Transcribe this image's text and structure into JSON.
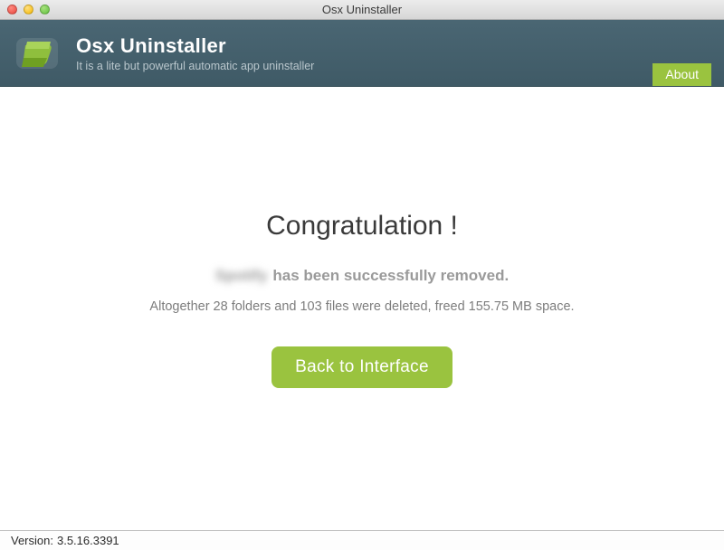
{
  "window": {
    "title": "Osx Uninstaller"
  },
  "header": {
    "app_title": "Osx Uninstaller",
    "tagline": "It is a lite but powerful automatic app uninstaller",
    "about_label": "About"
  },
  "result": {
    "heading": "Congratulation !",
    "removed_app_name": "Spotify",
    "removed_suffix": "has been successfully removed.",
    "stats_prefix": "Altogether",
    "folders_count": 28,
    "files_count": 103,
    "freed_space": "155.75 MB",
    "stats_full": "Altogether 28 folders and 103 files were deleted, freed 155.75 MB space.",
    "back_button_label": "Back to Interface"
  },
  "footer": {
    "version_label": "Version:",
    "version_value": "3.5.16.3391"
  },
  "colors": {
    "accent_green": "#9ac33f",
    "header_bg": "#3f5a66"
  }
}
